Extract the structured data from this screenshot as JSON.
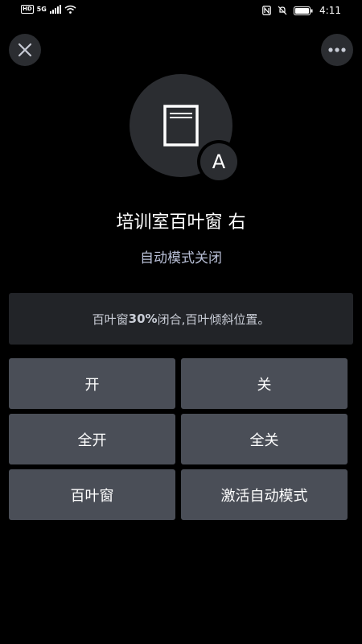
{
  "status_bar": {
    "left_badge": "HD",
    "network": "5G",
    "time": "4:11"
  },
  "header": {
    "close_icon": "close-icon",
    "more_icon": "more-dots-icon"
  },
  "device": {
    "icon": "window-blind-icon",
    "mode_badge": "A",
    "name": "培训室百叶窗 右",
    "mode_status": "自动模式关闭"
  },
  "status_panel": {
    "text_prefix": "百叶窗",
    "text_bold": "30%",
    "text_suffix": "闭合,百叶倾斜位置。"
  },
  "controls": {
    "open": "开",
    "close": "关",
    "open_all": "全开",
    "close_all": "全关",
    "blinds": "百叶窗",
    "activate_auto": "激活自动模式"
  },
  "colors": {
    "background": "#000000",
    "surface": "#2b2d31",
    "panel": "#222428",
    "button": "#4a4e57",
    "subtitle_text": "#b8bfd6"
  }
}
